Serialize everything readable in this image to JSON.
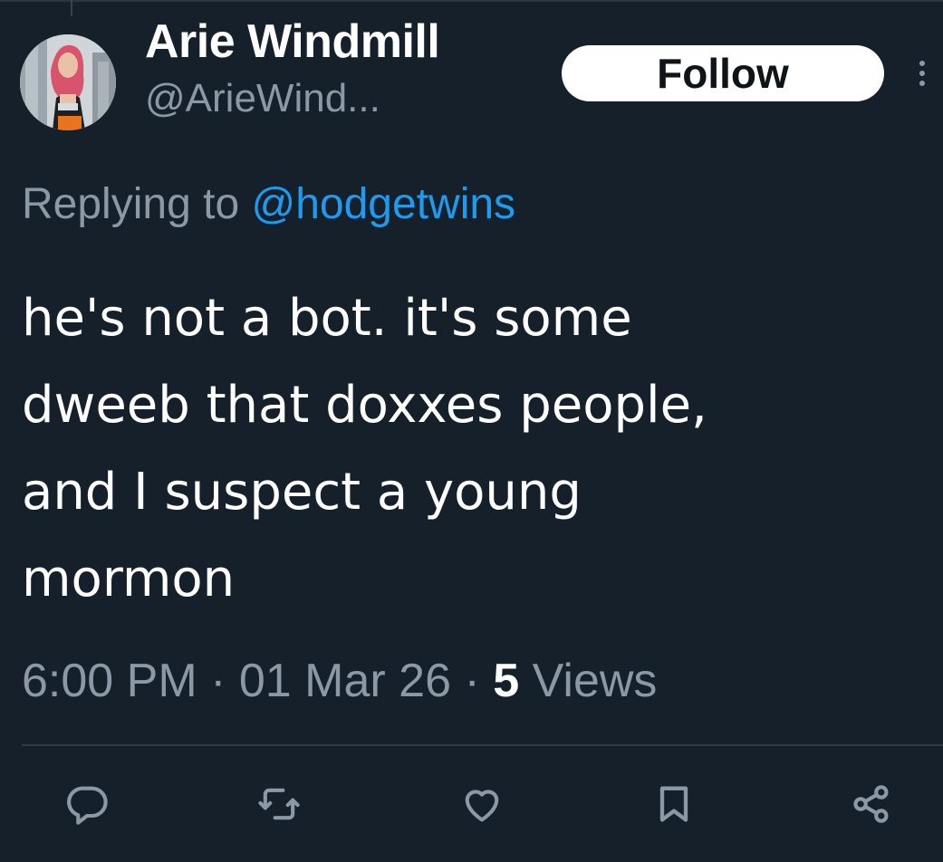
{
  "tweet": {
    "author": {
      "display_name": "Arie Windmill",
      "handle": "@ArieWind..."
    },
    "follow_label": "Follow",
    "replying_prefix": "Replying to",
    "replying_to": "@hodgetwins",
    "text_lines": [
      "he's not a bot. it's some",
      "dweeb that doxxes people,",
      "and I suspect a young",
      "mormon"
    ],
    "time": "6:00 PM",
    "date": "01 Mar 26",
    "separator": "·",
    "views_count": "5",
    "views_label": "Views"
  },
  "actions": [
    {
      "icon": "reply-icon"
    },
    {
      "icon": "retweet-icon"
    },
    {
      "icon": "like-icon"
    },
    {
      "icon": "bookmark-icon"
    },
    {
      "icon": "share-icon"
    }
  ],
  "colors": {
    "background": "#15202b",
    "primary_text": "#ffffff",
    "secondary_text": "#8b98a5",
    "link": "#1d9bf0",
    "divider": "#2f3a44"
  }
}
